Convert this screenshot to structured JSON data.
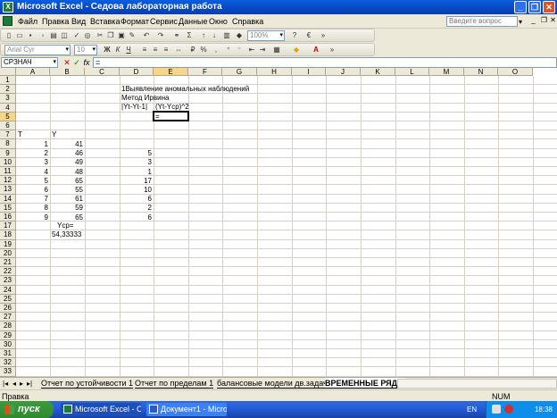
{
  "window": {
    "title": "Microsoft Excel - Седова лабораторная работа",
    "app_icon": "excel-icon"
  },
  "menu": {
    "items": [
      "Файл",
      "Правка",
      "Вид",
      "Вставка",
      "Формат",
      "Сервис",
      "Данные",
      "Окно",
      "Справка"
    ],
    "ask_placeholder": "Введите вопрос"
  },
  "toolbar": {
    "font_name": "Arial Cyr",
    "font_size": "10",
    "zoom": "100%",
    "sum_symbol": "Σ"
  },
  "formula_bar": {
    "name_box": "СРЗНАЧ",
    "fx": "fx",
    "formula": "="
  },
  "sheet": {
    "columns": [
      "A",
      "B",
      "C",
      "D",
      "E",
      "F",
      "G",
      "H",
      "I",
      "J",
      "K",
      "L",
      "M",
      "N",
      "O"
    ],
    "active_column": "E",
    "rows": [
      1,
      2,
      3,
      4,
      5,
      6,
      7,
      8,
      9,
      10,
      11,
      12,
      13,
      14,
      15,
      16,
      17,
      18,
      19,
      20,
      21,
      22,
      23,
      24,
      25,
      26,
      27,
      28,
      29,
      30,
      31,
      32,
      33
    ],
    "active_row": 5,
    "texts": {
      "d2": "1Выявление аномальных наблюдений",
      "d3": "Метод Ирвина",
      "d4": "|Yt-Yt-1|",
      "e4": "(Yt-Ycp)^2",
      "e5": "=",
      "a7": "T",
      "b7": "Y",
      "b17": "Ycp=",
      "b18": "54,33333"
    },
    "t_values": [
      "1",
      "2",
      "3",
      "4",
      "5",
      "6",
      "7",
      "8",
      "9"
    ],
    "y_values": [
      "41",
      "46",
      "49",
      "48",
      "65",
      "55",
      "61",
      "59",
      "65"
    ],
    "d_values": [
      "5",
      "3",
      "1",
      "17",
      "10",
      "6",
      "2",
      "6"
    ]
  },
  "tabs": {
    "items": [
      "Отчет по устойчивости 1",
      "Отчет по пределам 1",
      "балансовые модели дв.задачи",
      "ВРЕМЕННЫЕ РЯДЫ"
    ],
    "active_index": 3
  },
  "status": {
    "ready": "Правка",
    "num": "NUM"
  },
  "taskbar": {
    "start": "пуск",
    "items": [
      "Microsoft Excel - Сед...",
      "Документ1 - Microso..."
    ],
    "lang": "EN",
    "clock": "18:38"
  }
}
